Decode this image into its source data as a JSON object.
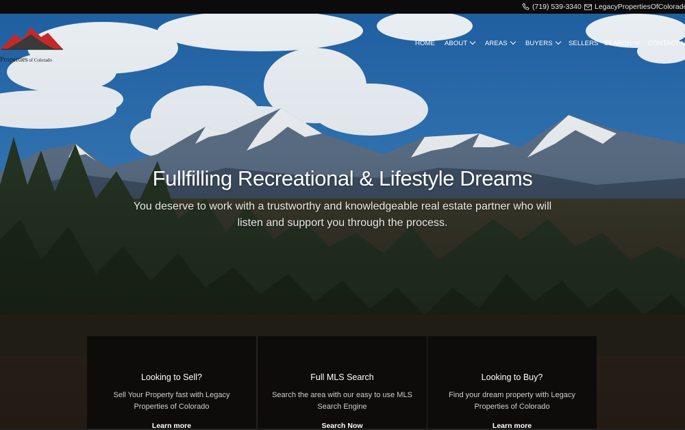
{
  "topbar": {
    "phone": "(719) 539-3340",
    "email": "LegacyPropertiesOfColorado@",
    "phone_icon": "phone-icon",
    "email_icon": "envelope-icon"
  },
  "logo": {
    "text_main": "Properties",
    "text_small": " of Colorado"
  },
  "nav": {
    "home": "HOME",
    "about": "ABOUT",
    "areas": "AREAS",
    "buyers": "BUYERS",
    "sellers": "SELLERS",
    "search": "SEARCH",
    "contact": "CONTACT US"
  },
  "hero": {
    "headline": "Fullfilling Recreational & Lifestyle Dreams",
    "subline": "You deserve to work with a trustworthy and knowledgeable real estate partner who will listen and support you through the process."
  },
  "cards": [
    {
      "title": "Looking to Sell?",
      "text": "Sell Your Property fast with Legacy Properties of Colorado",
      "link": "Learn more"
    },
    {
      "title": "Full MLS Search",
      "text": "Search the area with our easy to use MLS Search Engine",
      "link": "Search Now"
    },
    {
      "title": "Looking to Buy?",
      "text": "Find your dream property with Legacy Properties of Colorado",
      "link": "Learn more"
    }
  ],
  "colors": {
    "logo_red": "#c62828",
    "topbar": "#0b0b0b",
    "card_bg": "#0d0c0b"
  }
}
